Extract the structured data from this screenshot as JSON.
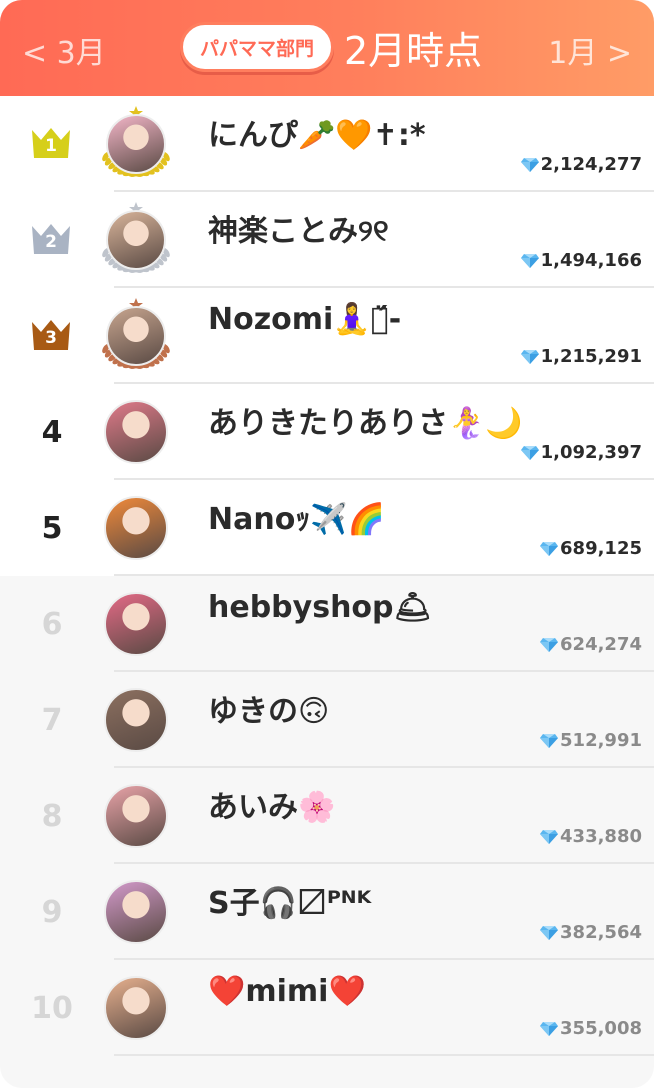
{
  "header": {
    "prev_month": "< 3月",
    "next_month": "1月 >",
    "division_label": "パパママ部門",
    "period_title": "2月時点"
  },
  "colors": {
    "header_start": "#ff6a55",
    "header_end": "#ff9c66",
    "gold": "#d6cf1a",
    "silver": "#a9b3c3",
    "bronze": "#a85a14",
    "gem": "#5ab6ef"
  },
  "ranking": [
    {
      "rank": "1",
      "name": "にんぴ🥕🧡✝︎:*",
      "score": "2,124,277",
      "badge": "crown-gold-icon",
      "avatar_color": "#f3b6c8"
    },
    {
      "rank": "2",
      "name": "神楽ことみ୨୧",
      "score": "1,494,166",
      "badge": "crown-silver-icon",
      "avatar_color": "#d8b49a"
    },
    {
      "rank": "3",
      "name": "Nozomi🧘‍♀️〼̈́-",
      "score": "1,215,291",
      "badge": "crown-bronze-icon",
      "avatar_color": "#c7a58f"
    },
    {
      "rank": "4",
      "name": "ありきたりありさ🧜‍♀️🌙",
      "score": "1,092,397",
      "badge": "",
      "avatar_color": "#e07a8a"
    },
    {
      "rank": "5",
      "name": "Nanoｯ✈️🌈",
      "score": "689,125",
      "badge": "",
      "avatar_color": "#f08a3a"
    },
    {
      "rank": "6",
      "name": "hebbyshop🛎",
      "score": "624,274",
      "badge": "",
      "avatar_color": "#e46a86"
    },
    {
      "rank": "7",
      "name": "ゆきの🙃",
      "score": "512,991",
      "badge": "",
      "avatar_color": "#8c7060"
    },
    {
      "rank": "8",
      "name": "あいみ🌸",
      "score": "433,880",
      "badge": "",
      "avatar_color": "#e8a3a8"
    },
    {
      "rank": "9",
      "name": "S子🎧〼ᴾᴺᴷ",
      "score": "382,564",
      "badge": "",
      "avatar_color": "#d39acb"
    },
    {
      "rank": "10",
      "name": "❤️mimi❤️",
      "score": "355,008",
      "badge": "",
      "avatar_color": "#e6b08e"
    }
  ]
}
